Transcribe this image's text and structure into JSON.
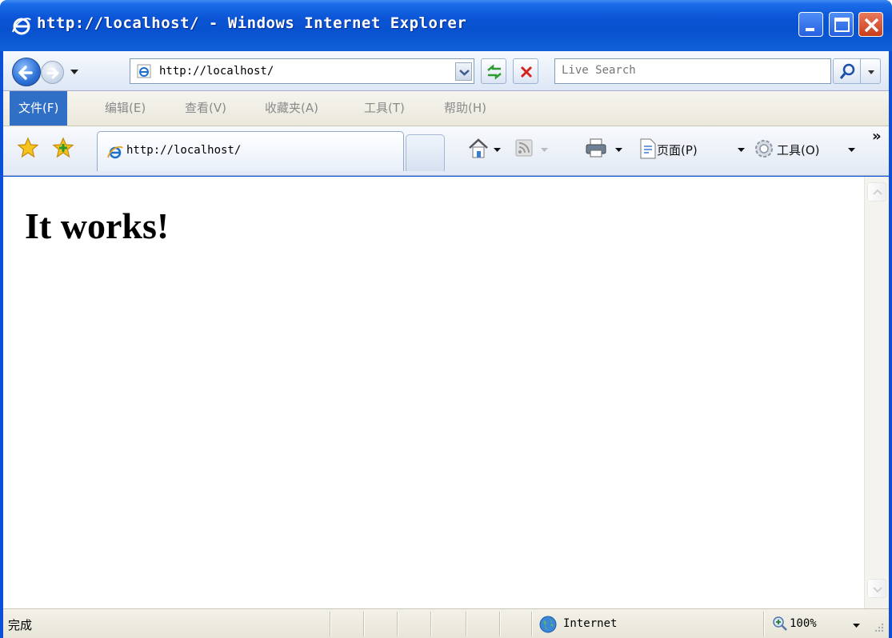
{
  "window": {
    "title": "http://localhost/ - Windows Internet Explorer"
  },
  "icons": {
    "title": "ie-icon",
    "back": "back-arrow-icon",
    "forward": "forward-arrow-icon",
    "refresh": "refresh-icon",
    "stop": "stop-icon",
    "search": "search-icon",
    "favorites": "favorites-star-icon",
    "add_favorites": "add-favorites-icon",
    "home": "home-icon",
    "feeds": "feeds-icon",
    "print": "print-icon",
    "page": "page-icon",
    "tools": "gear-icon",
    "zone": "globe-icon",
    "zoom": "zoom-icon"
  },
  "address_bar": {
    "url": "http://localhost/"
  },
  "search": {
    "placeholder": "Live Search"
  },
  "menu": {
    "items": [
      {
        "label": "文件(F)",
        "active": true
      },
      {
        "label": "编辑(E)",
        "active": false
      },
      {
        "label": "查看(V)",
        "active": false
      },
      {
        "label": "收藏夹(A)",
        "active": false
      },
      {
        "label": "工具(T)",
        "active": false
      },
      {
        "label": "帮助(H)",
        "active": false
      }
    ]
  },
  "tabs": [
    {
      "title": "http://localhost/"
    }
  ],
  "command_bar": {
    "page_label": "页面(P)",
    "tools_label": "工具(O)",
    "overflow": "»"
  },
  "content": {
    "heading": "It works!"
  },
  "status": {
    "text": "完成",
    "zone": "Internet",
    "zoom": "100%"
  },
  "colors": {
    "titlebar": "#0b55d6",
    "menu_active": "#2f6fc6",
    "stop": "#d4221c"
  }
}
